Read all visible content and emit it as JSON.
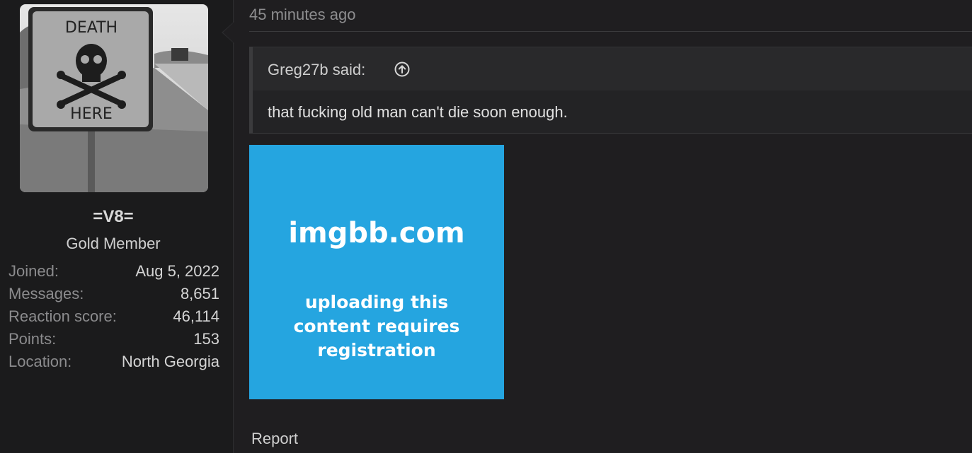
{
  "user": {
    "avatar_icon": "death-here-road-sign",
    "avatar_sign_text": [
      "DEATH",
      "HERE"
    ],
    "username": "=V8=",
    "title": "Gold Member",
    "extras": [
      {
        "label": "Joined:",
        "value": "Aug 5, 2022"
      },
      {
        "label": "Messages:",
        "value": "8,651"
      },
      {
        "label": "Reaction score:",
        "value": "46,114"
      },
      {
        "label": "Points:",
        "value": "153"
      },
      {
        "label": "Location:",
        "value": "North Georgia"
      }
    ]
  },
  "message": {
    "time": "45 minutes ago",
    "quote": {
      "author": "Greg27b said:",
      "arrow_icon": "circle-arrow-up-icon",
      "text": "that fucking old man can't die soon enough."
    },
    "embed": {
      "site": "imgbb.com",
      "note_lines": [
        "uploading this",
        "content requires",
        "registration"
      ],
      "color": "#25a5e0"
    },
    "report_label": "Report"
  }
}
